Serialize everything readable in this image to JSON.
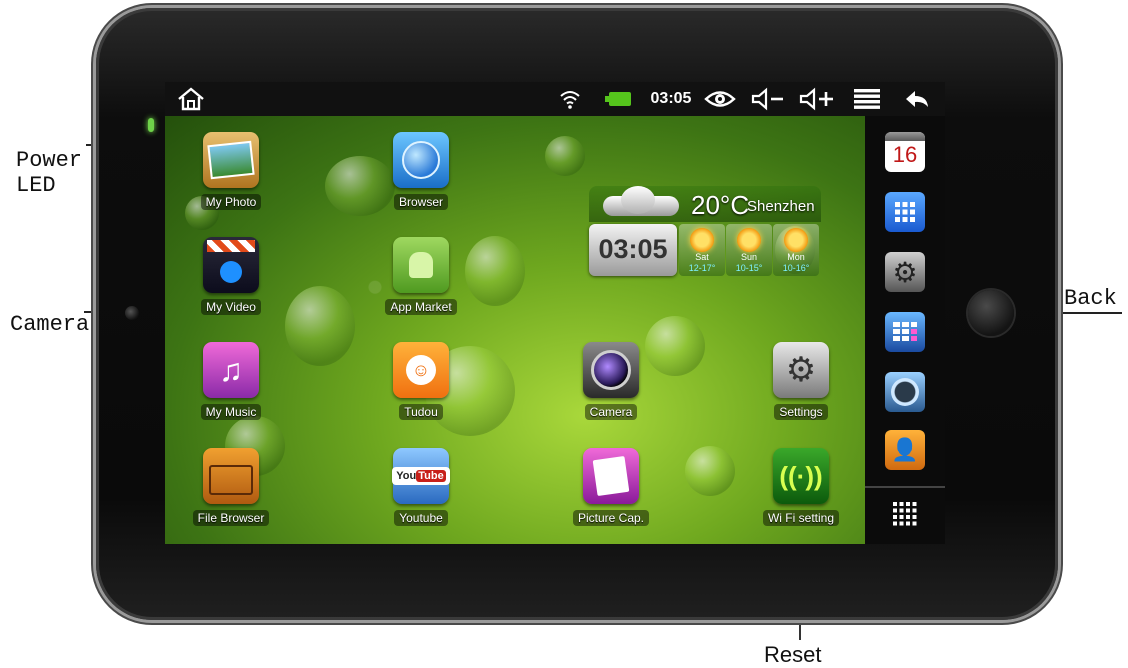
{
  "callouts": {
    "power_led": [
      "Power",
      "LED"
    ],
    "camera": "Camera",
    "back": "Back",
    "reset": "Reset"
  },
  "status_bar": {
    "icons": [
      "home-icon",
      "wifi-icon",
      "battery-icon",
      "eye-icon",
      "volume-down-icon",
      "volume-up-icon",
      "menu-icon",
      "back-arrow-icon"
    ],
    "time": "03:05",
    "battery_color": "#55c41c"
  },
  "apps": [
    {
      "label": "My Photo"
    },
    {
      "label": "Browser"
    },
    {
      "label": "My Video"
    },
    {
      "label": "App Market"
    },
    {
      "label": "My Music"
    },
    {
      "label": "Tudou"
    },
    {
      "label": "Camera"
    },
    {
      "label": "Settings"
    },
    {
      "label": "File Browser"
    },
    {
      "label": "Youtube"
    },
    {
      "label": "Picture Cap."
    },
    {
      "label": "Wi Fi setting"
    }
  ],
  "weather": {
    "temperature": "20°C",
    "city": "Shenzhen",
    "time": "03:05",
    "days": [
      {
        "day": "Sat",
        "range": "12-17°"
      },
      {
        "day": "Sun",
        "range": "10-15°"
      },
      {
        "day": "Mon",
        "range": "10-16°"
      }
    ]
  },
  "dock": {
    "calendar_date": "16",
    "icons": [
      "calendar-icon",
      "app-grid-icon",
      "settings-gears-icon",
      "calculator-icon",
      "clock-icon",
      "contacts-icon",
      "all-apps-icon"
    ]
  },
  "colors": {
    "wallpaper": "#5c9a1b",
    "accent_green": "#55c41c"
  }
}
